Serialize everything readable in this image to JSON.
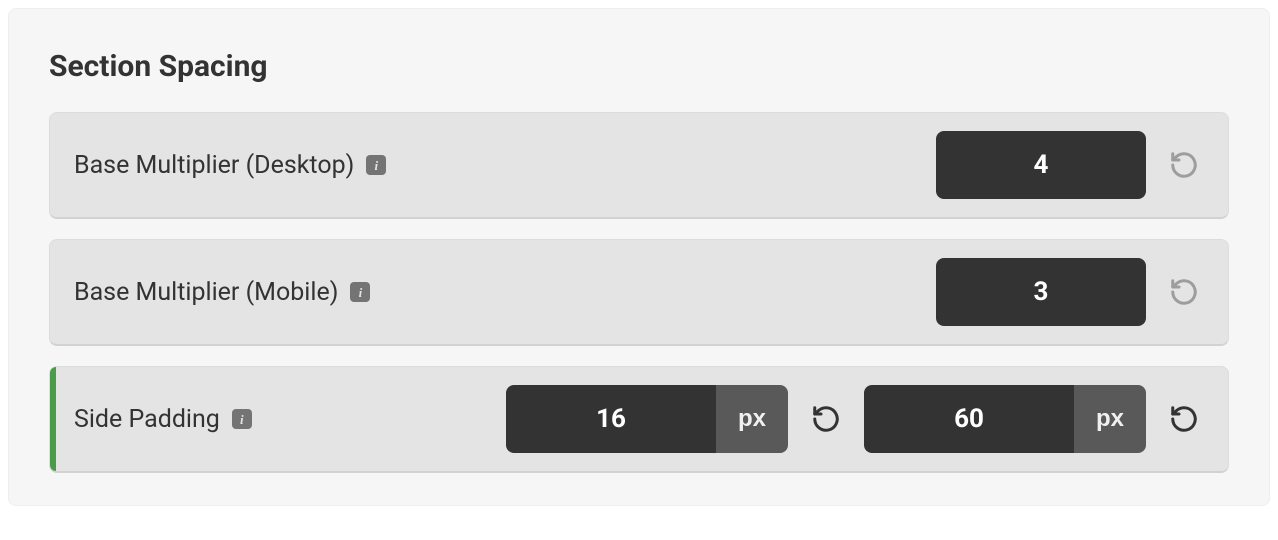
{
  "panel_title": "Section Spacing",
  "rows": {
    "desktop": {
      "label": "Base Multiplier (Desktop)",
      "value": "4"
    },
    "mobile": {
      "label": "Base Multiplier (Mobile)",
      "value": "3"
    },
    "side": {
      "label": "Side Padding",
      "value_a": "16",
      "unit_a": "px",
      "value_b": "60",
      "unit_b": "px"
    }
  }
}
